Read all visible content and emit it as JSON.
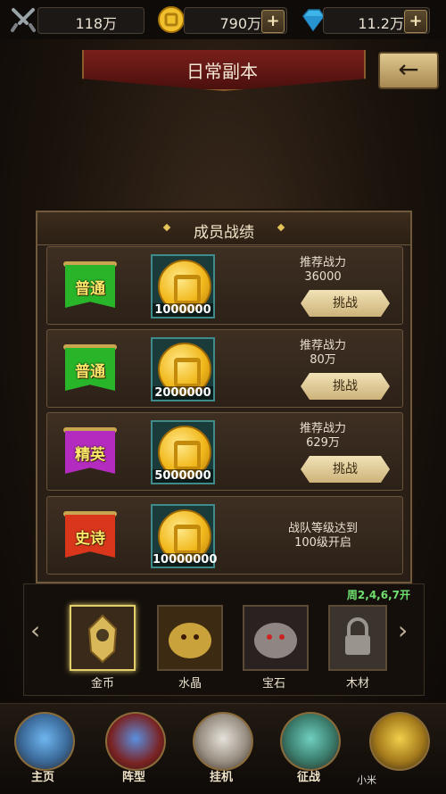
{
  "topbar": {
    "power": "118万",
    "gold": "790万",
    "gems": "11.2万",
    "plus_label": "+"
  },
  "header": {
    "title": "日常副本",
    "back_icon": "←"
  },
  "panel": {
    "title": "成员战绩",
    "rows": [
      {
        "tier": "普通",
        "tier_color": "#28b52a",
        "reward": "1000000",
        "req_line1": "推荐战力",
        "req_line2": "36000",
        "button": "挑战"
      },
      {
        "tier": "普通",
        "tier_color": "#28b52a",
        "reward": "2000000",
        "req_line1": "推荐战力",
        "req_line2": "80万",
        "button": "挑战"
      },
      {
        "tier": "精英",
        "tier_color": "#b42cbf",
        "reward": "5000000",
        "req_line1": "推荐战力",
        "req_line2": "629万",
        "button": "挑战"
      },
      {
        "tier": "史诗",
        "tier_color": "#d9361b",
        "reward": "10000000",
        "req_line1": "战队等级达到",
        "req_line2": "100级开启",
        "button": ""
      }
    ]
  },
  "dungeon_select": {
    "schedule": "周2,4,6,7开",
    "items": [
      {
        "label": "金币",
        "selected": true
      },
      {
        "label": "水晶",
        "selected": false
      },
      {
        "label": "宝石",
        "selected": false
      },
      {
        "label": "木材",
        "selected": false
      }
    ],
    "left_arrow": "‹",
    "right_arrow": "›"
  },
  "nav": {
    "items": [
      "主页",
      "阵型",
      "挂机",
      "征战",
      ""
    ]
  },
  "watermark": "小米"
}
